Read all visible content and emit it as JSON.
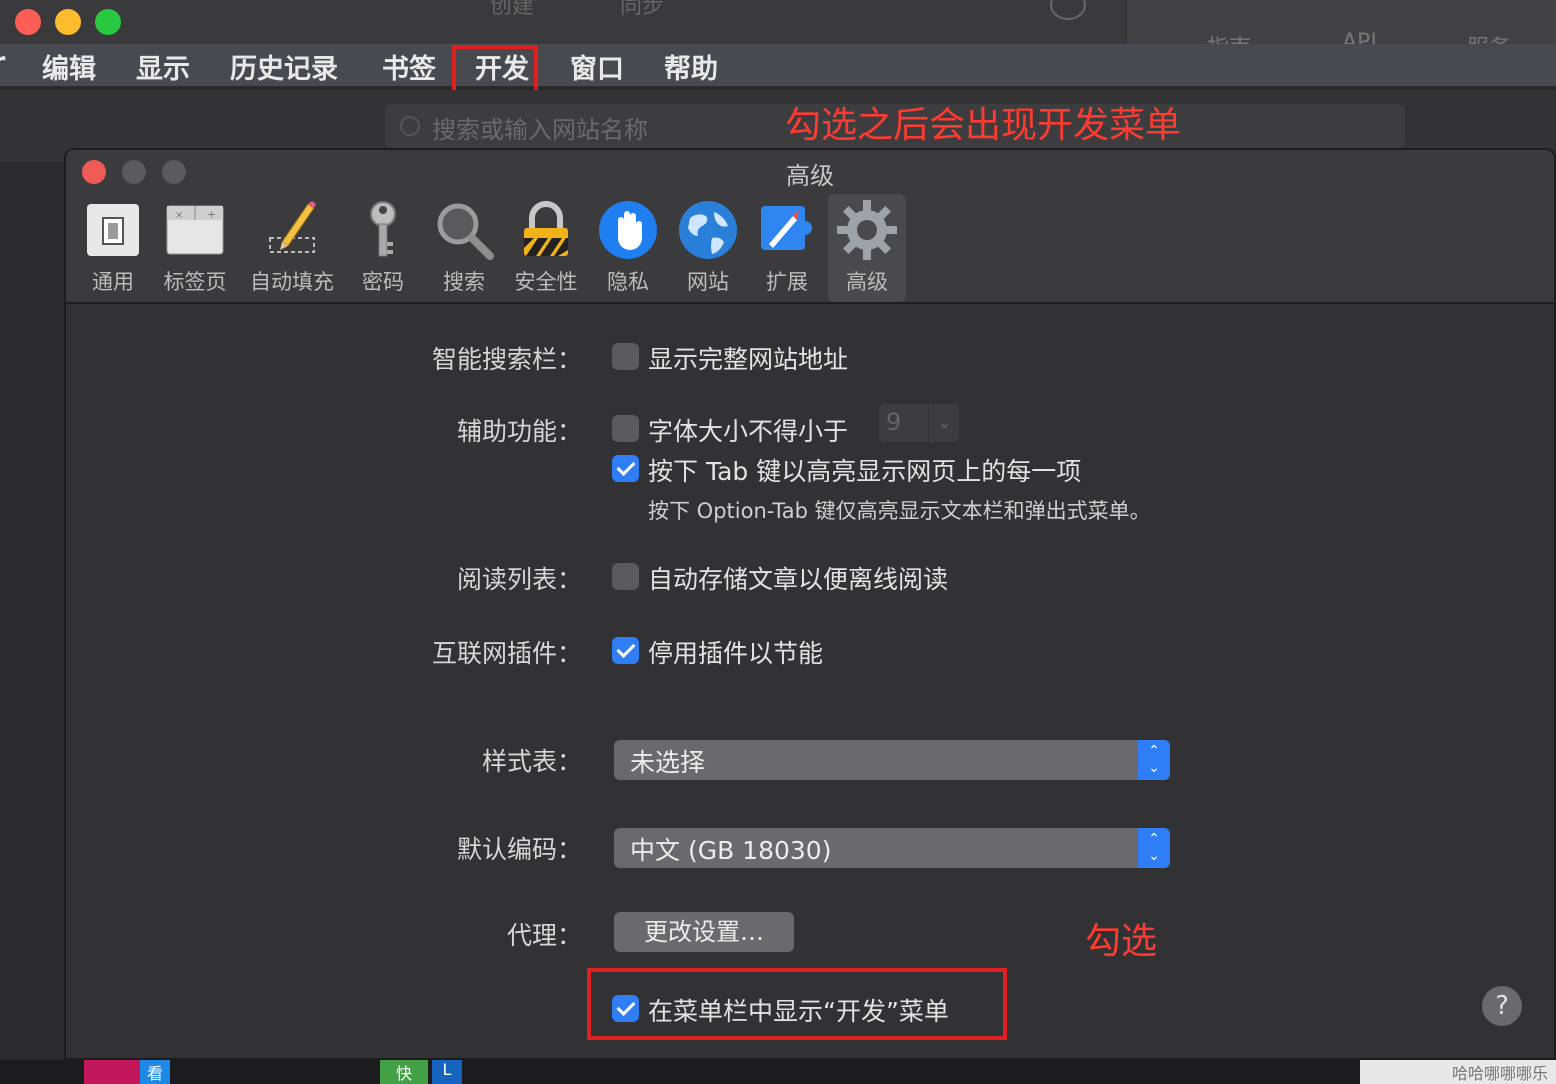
{
  "menubar": {
    "items": [
      "编辑",
      "显示",
      "历史记录",
      "书签",
      "开发",
      "窗口",
      "帮助"
    ],
    "partial_left": "r"
  },
  "background": {
    "toolbar_labels": [
      "创建",
      "同步"
    ],
    "tab_labels": [
      "指南",
      "API",
      "服务"
    ],
    "url_placeholder": "搜索或输入网站名称",
    "dock_labels": [
      "看",
      "快",
      "L",
      "哈哈哪哪哪乐"
    ]
  },
  "annotations": {
    "top_note": "勾选之后会出现开发菜单",
    "bottom_note": "勾选"
  },
  "prefs": {
    "title": "高级",
    "tabs": [
      {
        "label": "通用",
        "icon": "general-switch-icon"
      },
      {
        "label": "标签页",
        "icon": "tabs-icon"
      },
      {
        "label": "自动填充",
        "icon": "pencil-icon"
      },
      {
        "label": "密码",
        "icon": "key-icon"
      },
      {
        "label": "搜索",
        "icon": "magnifier-icon"
      },
      {
        "label": "安全性",
        "icon": "padlock-icon"
      },
      {
        "label": "隐私",
        "icon": "hand-icon"
      },
      {
        "label": "网站",
        "icon": "globe-icon"
      },
      {
        "label": "扩展",
        "icon": "puzzle-compass-icon"
      },
      {
        "label": "高级",
        "icon": "gear-icon"
      }
    ],
    "selected_tab": "高级",
    "smart_search": {
      "label": "智能搜索栏：",
      "option": "显示完整网站地址",
      "checked": false
    },
    "accessibility": {
      "label": "辅助功能：",
      "min_font_option": "字体大小不得小于",
      "min_font_checked": false,
      "min_font_value": "9",
      "tab_option": "按下 Tab 键以高亮显示网页上的每一项",
      "tab_checked": true,
      "hint": "按下 Option-Tab 键仅高亮显示文本栏和弹出式菜单。"
    },
    "reading_list": {
      "label": "阅读列表：",
      "option": "自动存储文章以便离线阅读",
      "checked": false
    },
    "plugins": {
      "label": "互联网插件：",
      "option": "停用插件以节能",
      "checked": true
    },
    "stylesheet": {
      "label": "样式表：",
      "value": "未选择"
    },
    "encoding": {
      "label": "默认编码：",
      "value": "中文 (GB 18030)"
    },
    "proxy": {
      "label": "代理：",
      "button": "更改设置…"
    },
    "develop_menu": {
      "option": "在菜单栏中显示“开发”菜单",
      "checked": true
    },
    "help": "?"
  },
  "colors": {
    "accent": "#2f7ef6",
    "annotation_red": "#ff3b30",
    "window_bg": "#323234"
  }
}
